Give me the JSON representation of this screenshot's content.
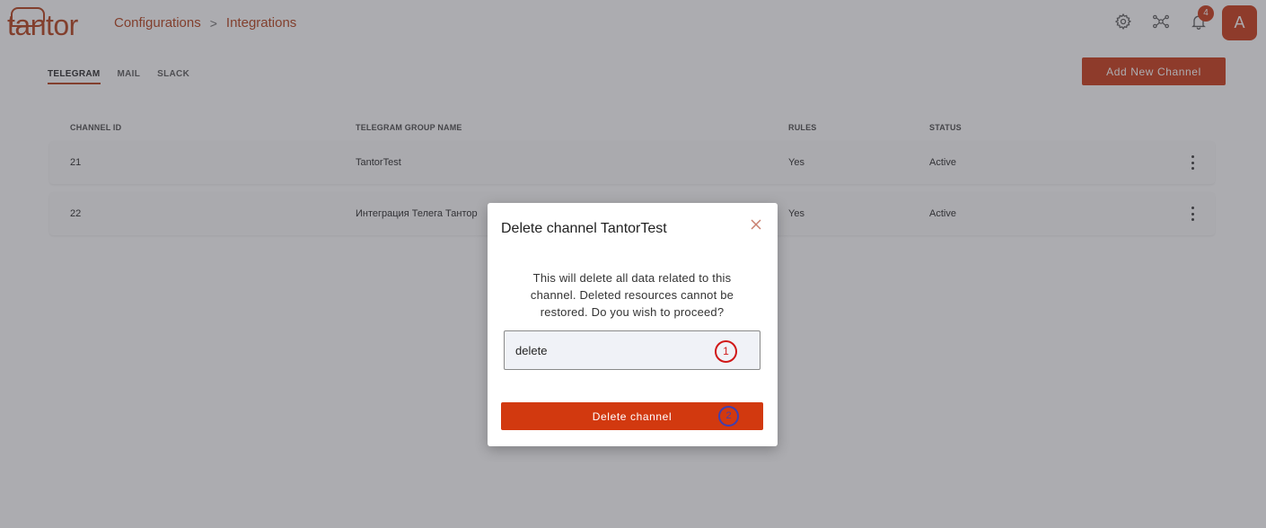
{
  "app": {
    "logo_text": "tantor"
  },
  "breadcrumb": {
    "items": [
      "Configurations",
      "Integrations"
    ],
    "separator": ">"
  },
  "header": {
    "notification_count": "4",
    "avatar_initial": "A",
    "icons": [
      "gear-icon",
      "graph-icon",
      "bell-icon"
    ]
  },
  "tabs": [
    {
      "label": "TELEGRAM",
      "active": true
    },
    {
      "label": "MAIL",
      "active": false
    },
    {
      "label": "SLACK",
      "active": false
    }
  ],
  "add_button_label": "Add New Channel",
  "table": {
    "columns": [
      "CHANNEL ID",
      "TELEGRAM GROUP NAME",
      "RULES",
      "STATUS"
    ],
    "rows": [
      {
        "id": "21",
        "group": "TantorTest",
        "rules": "Yes",
        "status": "Active"
      },
      {
        "id": "22",
        "group": "Интеграция Телега Тантор",
        "rules": "Yes",
        "status": "Active"
      }
    ]
  },
  "modal": {
    "title": "Delete channel TantorTest",
    "description": "This will delete all data related to this channel. Deleted resources cannot be restored. Do you wish to proceed?",
    "input_value": "delete",
    "button_label": "Delete channel",
    "marker_1": "1",
    "marker_2": "2"
  },
  "colors": {
    "brand": "#c9320d",
    "overlay": "rgba(70,70,80,0.45)"
  }
}
